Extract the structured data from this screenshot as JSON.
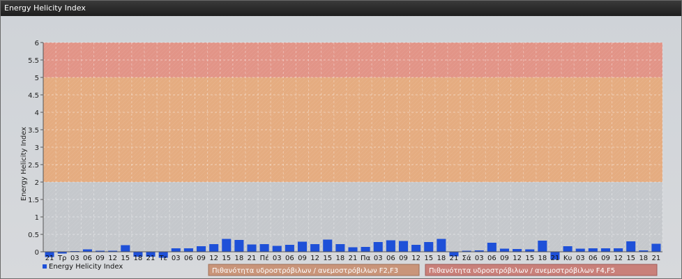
{
  "window": {
    "title": "Energy Helicity Index"
  },
  "chart_data": {
    "type": "bar",
    "title": "",
    "ylabel": "Energy Helicity Index",
    "ylim": [
      0,
      6
    ],
    "yticks": [
      0,
      0.5,
      1,
      1.5,
      2,
      2.5,
      3,
      3.5,
      4,
      4.5,
      5,
      5.5,
      6
    ],
    "ytick_labels": [
      "0",
      "0.5",
      "1",
      "1.5",
      "2",
      "2.5",
      "3",
      "3.5",
      "4",
      "4.5",
      "5",
      "5.5",
      "6"
    ],
    "grid": true,
    "bands": [
      {
        "from": 2,
        "to": 5,
        "color": "#e8a878",
        "label": "Πιθανότητα υδροστρόβιλων / ανεμοστρόβιλων F2,F3"
      },
      {
        "from": 5,
        "to": 6,
        "color": "#e48e80",
        "label": "Πιθανότητα υδροστρόβιλων / ανεμοστρόβιλων F4,F5"
      }
    ],
    "categories": [
      "21",
      "Τρ",
      "03",
      "06",
      "09",
      "12",
      "15",
      "18",
      "21",
      "Τε",
      "03",
      "06",
      "09",
      "12",
      "15",
      "18",
      "21",
      "Πέ",
      "03",
      "06",
      "09",
      "12",
      "15",
      "18",
      "21",
      "Πα",
      "03",
      "06",
      "09",
      "12",
      "15",
      "18",
      "21",
      "Σά",
      "03",
      "06",
      "09",
      "12",
      "15",
      "18",
      "21",
      "Κυ",
      "03",
      "06",
      "09",
      "12",
      "15",
      "18",
      "21"
    ],
    "series": [
      {
        "name": "Energy Helicity Index",
        "color": "#1e50d8",
        "values": [
          -0.15,
          -0.05,
          0.02,
          0.07,
          0.03,
          0.03,
          0.19,
          -0.14,
          -0.14,
          -0.17,
          0.1,
          0.1,
          0.16,
          0.22,
          0.37,
          0.34,
          0.21,
          0.22,
          0.17,
          0.2,
          0.29,
          0.22,
          0.35,
          0.22,
          0.13,
          0.14,
          0.28,
          0.33,
          0.31,
          0.2,
          0.28,
          0.37,
          -0.13,
          0.03,
          0.04,
          0.26,
          0.09,
          0.08,
          0.07,
          0.32,
          -0.22,
          0.16,
          0.09,
          0.1,
          0.1,
          0.1,
          0.3,
          0.04,
          0.23
        ]
      }
    ],
    "legend": {
      "position": "bottom-left"
    }
  }
}
